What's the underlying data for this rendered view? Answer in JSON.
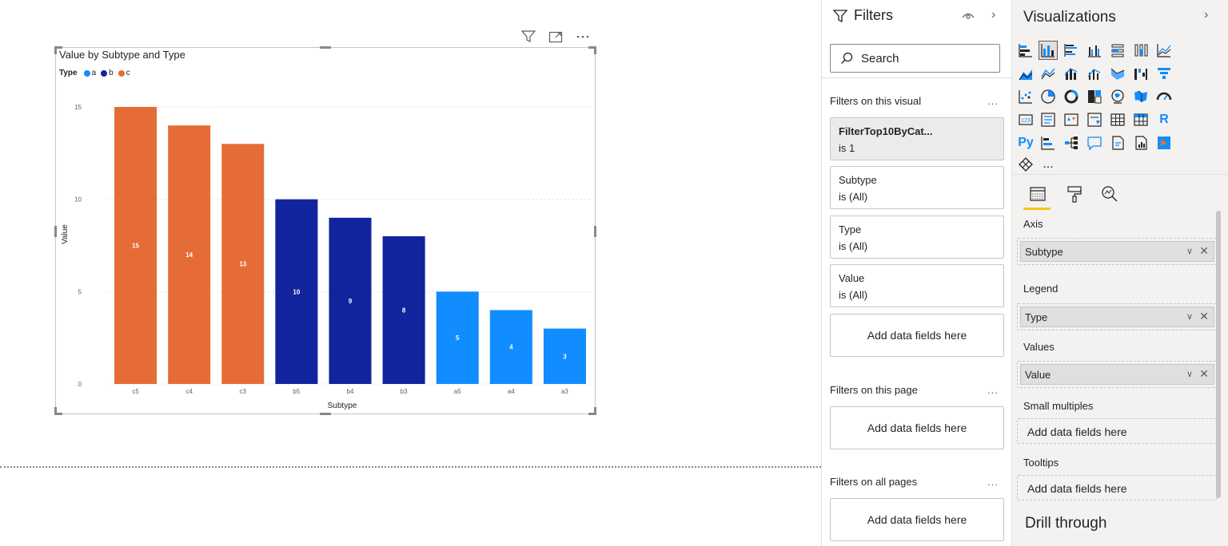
{
  "visual": {
    "title": "Value by Subtype and Type",
    "legend_title": "Type",
    "header_icons": [
      "filter-icon",
      "focus-mode-icon",
      "more-options-icon"
    ]
  },
  "chart_data": {
    "type": "bar",
    "title": "Value by Subtype and Type",
    "xlabel": "Subtype",
    "ylabel": "Value",
    "ylim": [
      0,
      15
    ],
    "yticks": [
      0,
      5,
      10,
      15
    ],
    "categories": [
      "c5",
      "c4",
      "c3",
      "b5",
      "b4",
      "b3",
      "a5",
      "a4",
      "a3"
    ],
    "values": [
      15,
      14,
      13,
      10,
      9,
      8,
      5,
      4,
      3
    ],
    "types": [
      "c",
      "c",
      "c",
      "b",
      "b",
      "b",
      "a",
      "a",
      "a"
    ],
    "legend": [
      {
        "name": "a",
        "color": "#118DFF"
      },
      {
        "name": "b",
        "color": "#12239E"
      },
      {
        "name": "c",
        "color": "#E66C37"
      }
    ],
    "data_labels": true,
    "grid": true
  },
  "filters": {
    "title": "Filters",
    "search_placeholder": "Search",
    "on_visual_label": "Filters on this visual",
    "cards": [
      {
        "name": "FilterTop10ByCat...",
        "value": "is 1"
      },
      {
        "name": "Subtype",
        "value": "is (All)"
      },
      {
        "name": "Type",
        "value": "is (All)"
      },
      {
        "name": "Value",
        "value": "is (All)"
      }
    ],
    "add_fields": "Add data fields here",
    "on_page_label": "Filters on this page",
    "on_all_pages_label": "Filters on all pages",
    "more": "..."
  },
  "visualizations": {
    "title": "Visualizations",
    "more_visuals": "...",
    "wells": {
      "axis_label": "Axis",
      "axis_field": "Subtype",
      "legend_label": "Legend",
      "legend_field": "Type",
      "values_label": "Values",
      "values_field": "Value",
      "small_multiples_label": "Small multiples",
      "tooltips_label": "Tooltips",
      "add_fields": "Add data fields here"
    },
    "drill_through": "Drill through",
    "visual_icons": [
      "R",
      "Py",
      "123"
    ]
  }
}
